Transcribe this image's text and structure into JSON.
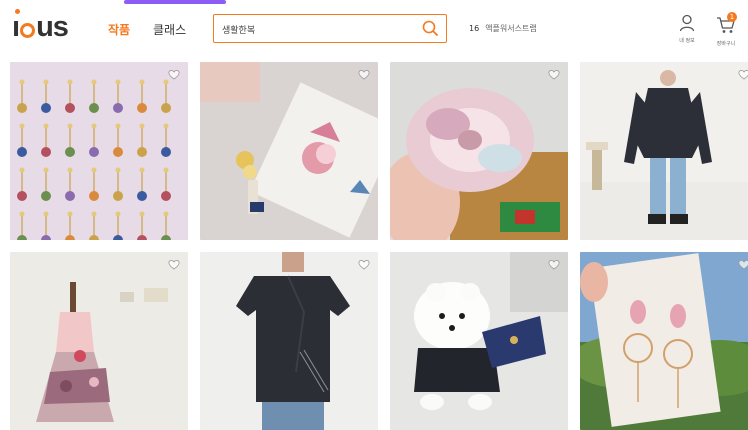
{
  "brand": {
    "logo": "idus"
  },
  "nav": {
    "tab_product": "작품",
    "tab_class": "클래스"
  },
  "search": {
    "value": "생활한복"
  },
  "trend": {
    "rank": "16",
    "keyword": "액플워서스트랩"
  },
  "header_icons": {
    "user_label": "내 정보",
    "cart_label": "장바구니",
    "cart_count": "1"
  },
  "products": [
    {
      "alt": "earrings"
    },
    {
      "alt": "hanbok-norigae"
    },
    {
      "alt": "scrunchie"
    },
    {
      "alt": "navy-jacket"
    },
    {
      "alt": "hanbok-dress"
    },
    {
      "alt": "mens-hanbok"
    },
    {
      "alt": "dog-hanbok"
    },
    {
      "alt": "drop-earrings"
    }
  ]
}
